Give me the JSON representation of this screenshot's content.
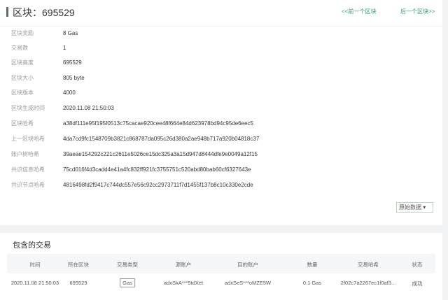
{
  "header": {
    "title": "区块：695529",
    "prev": "<<前一个区块",
    "next": "后一个区块>>"
  },
  "details": [
    {
      "label": "区块奖励",
      "value": "8 Gas"
    },
    {
      "label": "交易数",
      "value": "1"
    },
    {
      "label": "区块高度",
      "value": "695529"
    },
    {
      "label": "区块大小",
      "value": "805 byte"
    },
    {
      "label": "区块版本",
      "value": "4000"
    },
    {
      "label": "区块生成时间",
      "value": "2020.11.08 21:50:03"
    },
    {
      "label": "区块哈希",
      "value": "a38df111e95f195f0513c75cacae920cee48f664e84d623978bd94c95de6eec5"
    },
    {
      "label": "上一区块哈希",
      "value": "4da7cd9fc1548709b3821c868787da095c26d380a2ae948b717a920b04818c37"
    },
    {
      "label": "账户树哈希",
      "value": "39aeae154292c221c2611e5026ce15dc325a3a15d947d8444dfe9e0049a12f15"
    },
    {
      "label": "共识信息哈希",
      "value": "75cd016f4d3cadd4e41a4fc832ff921fc3755751c520abd80bab60cf6327643e"
    },
    {
      "label": "共识节点哈希",
      "value": "4816498fd2f9417c744dc557e56c92cc2973711f7d1455f137b8c10c330e2cde"
    }
  ],
  "raw_button": "原始数据 ▾",
  "transactions": {
    "title": "包含的交易",
    "columns": [
      "时间",
      "所在区块",
      "交易类型",
      "源账户",
      "目的账户",
      "数量",
      "交易哈希",
      "状态"
    ],
    "rows": [
      [
        "2020.11.08 21:50:03",
        "695529",
        "Gas",
        "adxSkA***5tdXet",
        "adxSeS***oMZE5W",
        "0.1 Gas",
        "2f02c7a2267ec1f0af3...",
        "成功"
      ]
    ]
  }
}
